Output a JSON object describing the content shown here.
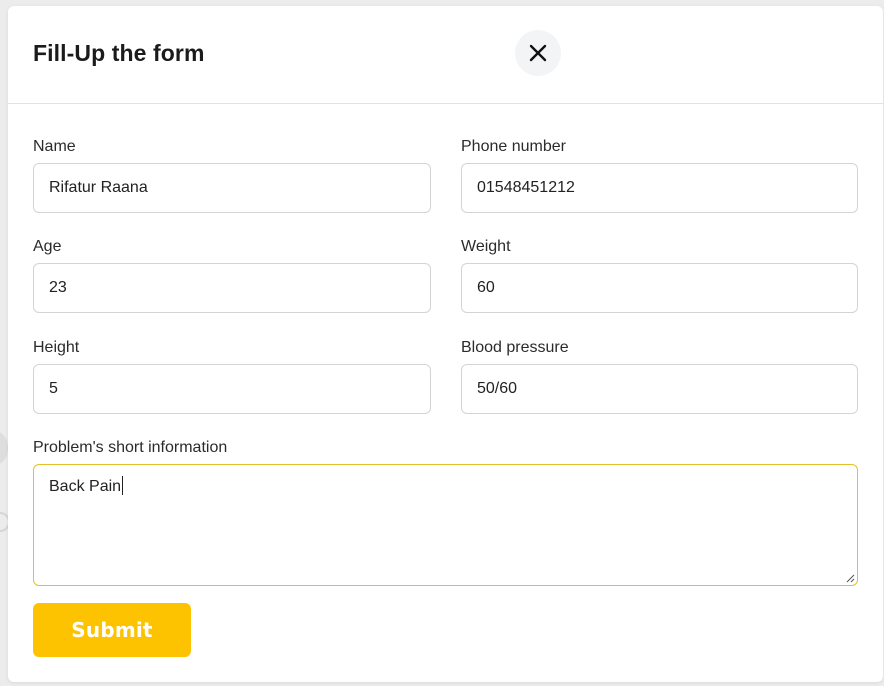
{
  "modal": {
    "title": "Fill-Up the form",
    "close_icon": "close-icon"
  },
  "form": {
    "fields": {
      "name": {
        "label": "Name",
        "value": "Rifatur Raana"
      },
      "phone": {
        "label": "Phone number",
        "value": "01548451212"
      },
      "age": {
        "label": "Age",
        "value": "23"
      },
      "weight": {
        "label": "Weight",
        "value": "60"
      },
      "height": {
        "label": "Height",
        "value": "5"
      },
      "blood_pressure": {
        "label": "Blood pressure",
        "value": "50/60"
      }
    },
    "problem": {
      "label": "Problem's short information",
      "value": "Back Pain"
    },
    "submit_label": "Submit"
  },
  "colors": {
    "accent": "#fdc300",
    "textarea_focus_border": "#e6c029",
    "input_border": "#d4d4d4",
    "close_button_bg": "#f3f4f6"
  }
}
